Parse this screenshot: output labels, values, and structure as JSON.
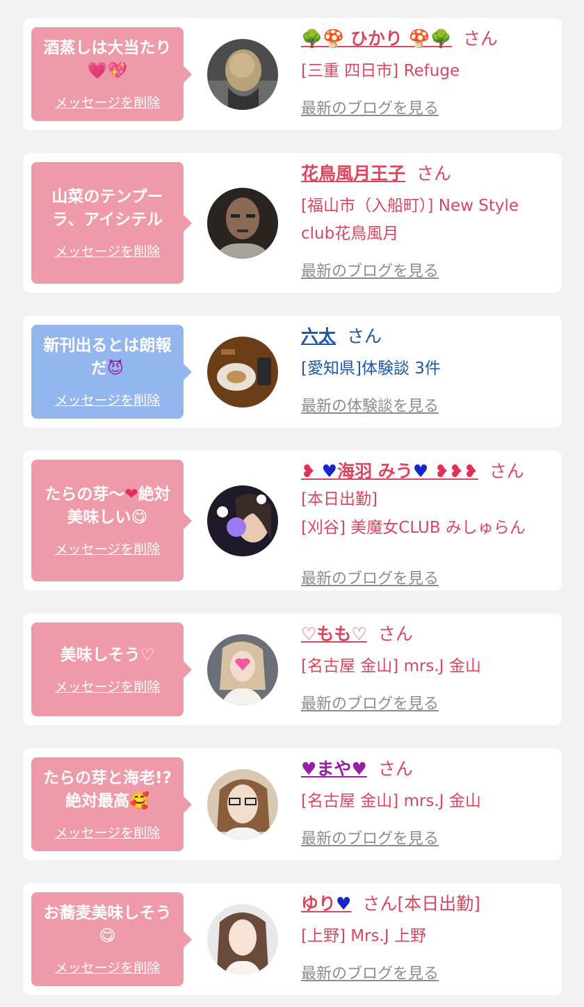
{
  "items": [
    {
      "message": "酒蒸しは大当たり",
      "delete_label": "メッセージを削除",
      "name": "ひかり",
      "san": "さん",
      "location": "[三重 四日市] Refuge",
      "blog_label": "最新のブログを見る"
    },
    {
      "message": "山菜のテンプーラ、アイシテル",
      "delete_label": "メッセージを削除",
      "name": "花鳥風月王子",
      "san": "さん",
      "location": "[福山市（入船町）] New Style club花鳥風月",
      "blog_label": "最新のブログを見る"
    },
    {
      "message": "新刊出るとは朗報だ",
      "delete_label": "メッセージを削除",
      "name": "六太",
      "san": "さん",
      "location": "[愛知県]体験談 3件",
      "blog_label": "最新の体験談を見る"
    },
    {
      "message_a": "たらの芽〜",
      "message_b": "絶対美味しい",
      "delete_label": "メッセージを削除",
      "name": "海羽 みう",
      "san": "さん",
      "status": "[本日出勤]",
      "location": "[刈谷] 美魔女CLUB みしゅらん",
      "blog_label": "最新のブログを見る"
    },
    {
      "message": "美味しそう♡",
      "delete_label": "メッセージを削除",
      "name": "♡もも♡",
      "san": "さん",
      "location": "[名古屋 金山] mrs.J 金山",
      "blog_label": "最新のブログを見る"
    },
    {
      "message": "たらの芽と海老!?絶対最高",
      "delete_label": "メッセージを削除",
      "name": "まや",
      "san": "さん",
      "location": "[名古屋 金山] mrs.J 金山",
      "blog_label": "最新のブログを見る"
    },
    {
      "message": "お蕎麦美味しそう",
      "delete_label": "メッセージを削除",
      "name": "ゆり",
      "san": "さん[本日出勤]",
      "location": "[上野] Mrs.J 上野",
      "blog_label": "最新のブログを見る"
    }
  ]
}
